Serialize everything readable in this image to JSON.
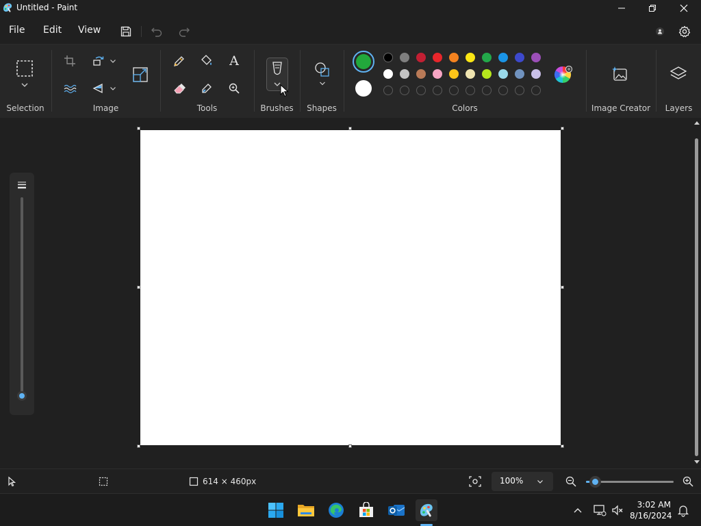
{
  "window": {
    "title": "Untitled - Paint"
  },
  "menu": {
    "file": "File",
    "edit": "Edit",
    "view": "View"
  },
  "ribbon": {
    "groups": {
      "selection": "Selection",
      "image": "Image",
      "tools": "Tools",
      "brushes": "Brushes",
      "shapes": "Shapes",
      "colors": "Colors",
      "image_creator": "Image Creator",
      "layers": "Layers"
    },
    "text_tool_glyph": "A"
  },
  "colors": {
    "primary": "#22a83c",
    "secondary": "#ffffff",
    "accent": "#5fb2f2",
    "palette_row1": [
      "#000000",
      "#7f7f7f",
      "#c21f33",
      "#e8262b",
      "#f4821f",
      "#fbe614",
      "#23a84a",
      "#1a94e6",
      "#3d49cc",
      "#9c4fb8"
    ],
    "palette_row2": [
      "#ffffff",
      "#c3c3c3",
      "#b97a57",
      "#f7a5c4",
      "#fcc419",
      "#efe4b0",
      "#b5e61d",
      "#99d9ea",
      "#7092be",
      "#c8bfe7"
    ],
    "custom_slots": 10
  },
  "status": {
    "canvas_size": "614 × 460px",
    "zoom": "100%",
    "zoom_level": 0.1
  },
  "brush_size_level": 0.0,
  "taskbar": {
    "time": "3:02 AM",
    "date": "8/16/2024",
    "apps": [
      "start-icon",
      "file-explorer-icon",
      "edge-icon",
      "store-icon",
      "outlook-icon",
      "paint-icon"
    ]
  }
}
